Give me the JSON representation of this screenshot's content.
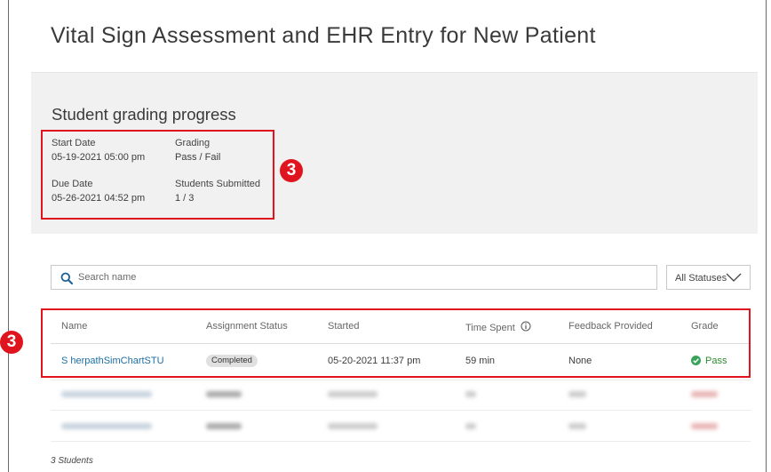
{
  "page": {
    "title": "Vital Sign Assessment and EHR Entry for New Patient"
  },
  "progress": {
    "heading": "Student grading progress",
    "start_date_label": "Start Date",
    "start_date_value": "05-19-2021 05:00 pm",
    "grading_label": "Grading",
    "grading_value": "Pass / Fail",
    "due_date_label": "Due Date",
    "due_date_value": "05-26-2021 04:52 pm",
    "submitted_label": "Students Submitted",
    "submitted_value": "1 / 3"
  },
  "callouts": {
    "first": "3",
    "second": "3"
  },
  "search": {
    "placeholder": "Search name",
    "value": ""
  },
  "status_filter": {
    "selected": "All Statuses"
  },
  "table": {
    "headers": [
      "Name",
      "Assignment Status",
      "Started",
      "Time Spent",
      "Feedback Provided",
      "Grade"
    ],
    "rows": [
      {
        "name": "S herpathSimChartSTU",
        "status": "Completed",
        "started": "05-20-2021 11:37 pm",
        "time_spent": "59 min",
        "feedback": "None",
        "grade": "Pass"
      }
    ]
  },
  "footer": {
    "count": "3 Students"
  },
  "colors": {
    "accent_red": "#e0141e",
    "link_blue": "#1c6ea4",
    "pass_green": "#3aa35a",
    "panel_bg": "#f1f1f1"
  },
  "icons": {
    "search": "search-icon",
    "chevron": "chevron-down-icon",
    "info": "info-icon",
    "pass": "check-circle-icon"
  }
}
